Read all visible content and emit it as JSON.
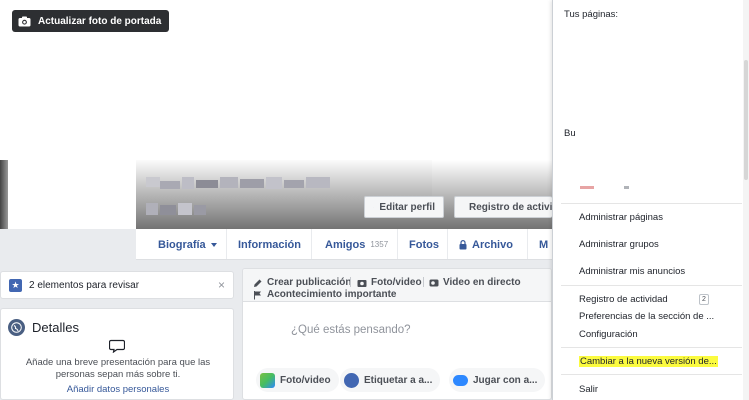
{
  "cover": {
    "update_button_label": "Actualizar foto de portada",
    "icon": "camera-icon"
  },
  "profile_actions": {
    "edit_profile_label": "Editar perfil",
    "activity_log_label": "Registro de activid"
  },
  "nav": {
    "tabs": [
      {
        "label": "Biografía"
      },
      {
        "label": "Información"
      },
      {
        "label": "Amigos",
        "count": "1357"
      },
      {
        "label": "Fotos"
      },
      {
        "label": "Archivo"
      },
      {
        "label": "M"
      }
    ]
  },
  "review": {
    "text": "2 elementos para revisar",
    "close": "×"
  },
  "details": {
    "title": "Detalles",
    "description": "Añade una breve presentación para que las personas sepan más sobre ti.",
    "link": "Añadir datos personales"
  },
  "composer": {
    "tabs": [
      {
        "label": "Crear publicación"
      },
      {
        "label": "Foto/video"
      },
      {
        "label": "Video en directo"
      },
      {
        "label": "Acontecimiento importante"
      }
    ],
    "placeholder": "¿Qué estás pensando?",
    "actions": [
      {
        "label": "Foto/video"
      },
      {
        "label": "Etiquetar a a..."
      },
      {
        "label": "Jugar con a..."
      }
    ]
  },
  "menu": {
    "pages_heading": "Tus páginas:",
    "sub_heading": "Bu",
    "items": [
      {
        "label": "Administrar páginas"
      },
      {
        "label": "Administrar grupos"
      },
      {
        "label": "Administrar mis anuncios"
      },
      {
        "label": "Registro de actividad",
        "badge": "2"
      },
      {
        "label": "Preferencias de la sección de ..."
      },
      {
        "label": "Configuración"
      },
      {
        "label": "Cambiar a la nueva versión de..."
      },
      {
        "label": "Salir"
      }
    ]
  },
  "colors": {
    "link_blue": "#365899",
    "highlight": "#fbfb3f",
    "facebook_blue": "#4267b2"
  }
}
